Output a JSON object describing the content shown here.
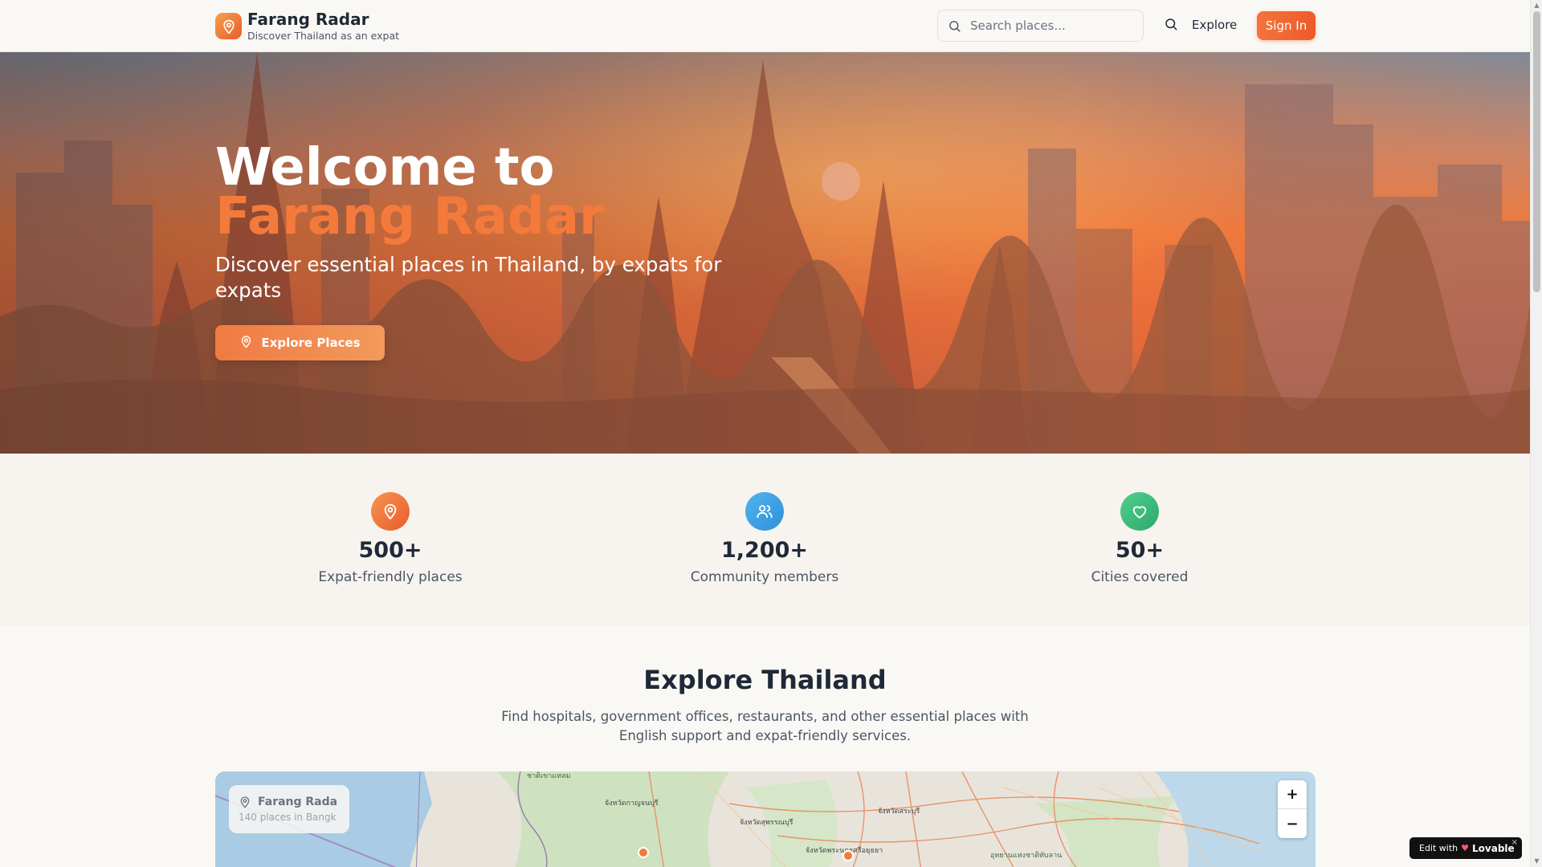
{
  "header": {
    "brand_title": "Farang Radar",
    "brand_subtitle": "Discover Thailand as an expat",
    "search_placeholder": "Search places...",
    "explore_label": "Explore",
    "signin_label": "Sign In"
  },
  "hero": {
    "title_line1": "Welcome to",
    "title_line2": "Farang Radar",
    "subtitle": "Discover essential places in Thailand, by expats for expats",
    "cta_label": "Explore Places"
  },
  "stats": [
    {
      "value": "500+",
      "label": "Expat-friendly places",
      "color": "#f07a42",
      "icon": "map-pin-icon"
    },
    {
      "value": "1,200+",
      "label": "Community members",
      "color": "#3b9fe0",
      "icon": "users-icon"
    },
    {
      "value": "50+",
      "label": "Cities covered",
      "color": "#3fbf82",
      "icon": "heart-icon"
    }
  ],
  "explore": {
    "title": "Explore Thailand",
    "description": "Find hospitals, government offices, restaurants, and other essential places with English support and expat-friendly services."
  },
  "map": {
    "card_title": "Farang Rada",
    "card_subtitle": "140 places in Bangk",
    "zoom_in": "+",
    "zoom_out": "−",
    "labels": [
      "ชาติเขาแหลม",
      "จังหวัดกาญจนบุรี",
      "จังหวัดสุพรรณบุรี",
      "จังหวัดสระบุรี",
      "จังหวัดพระนครศรีอยุธยา",
      "อุทยานแห่งชาติทับลาน"
    ]
  },
  "badge": {
    "prefix": "Edit with",
    "brand": "Lovable",
    "close": "×"
  },
  "colors": {
    "accent": "#ee5a2a",
    "accent_light": "#f47a3c"
  }
}
